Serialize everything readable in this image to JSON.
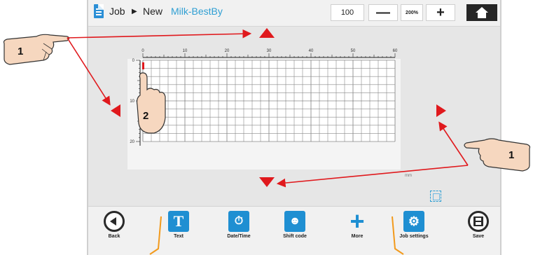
{
  "header": {
    "breadcrumb_root": "Job",
    "breadcrumb_separator": "▶",
    "breadcrumb_mode": "New",
    "job_name": "Milk-BestBy",
    "zoom_value": "100",
    "zoom_minus": "—",
    "zoom_max": "200%",
    "zoom_plus": "+",
    "home_icon": "home-icon"
  },
  "canvas": {
    "x_ticks": [
      "0",
      "10",
      "20",
      "30",
      "40",
      "50",
      "60"
    ],
    "y_ticks": [
      "0",
      "10",
      "20"
    ],
    "unit": "mm",
    "nudge_up_icon": "arrow-up-icon",
    "nudge_down_icon": "arrow-down-icon",
    "nudge_left_icon": "arrow-left-icon",
    "nudge_right_icon": "arrow-right-icon",
    "select_icon": "selection-frame-icon"
  },
  "toolbar": {
    "back": "Back",
    "text": "Text",
    "datetime": "Date/Time",
    "shiftcode": "Shift code",
    "more": "More",
    "jobsettings": "Job settings",
    "save": "Save"
  },
  "callouts": {
    "hand_left_number": "1",
    "hand_right_number": "1",
    "hand_touch_number": "2"
  },
  "colors": {
    "accent_blue": "#1f8fd2",
    "arrow_red": "#e0191d",
    "bracket_orange": "#f29a1c"
  }
}
